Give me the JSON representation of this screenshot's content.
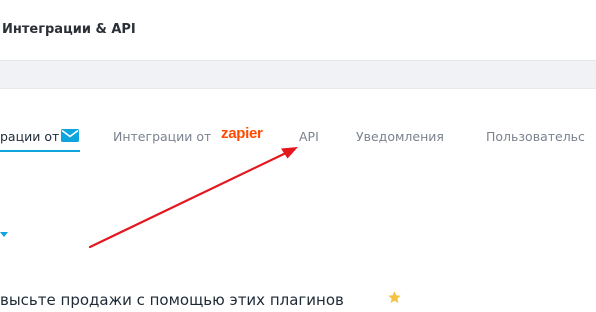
{
  "header": {
    "title": "Интеграции & API"
  },
  "tabs": [
    {
      "label": "рации от",
      "icon": "envelope-icon",
      "active": true
    },
    {
      "label": "Интеграции от",
      "brand": "zapier",
      "active": false
    },
    {
      "label": "API",
      "active": false
    },
    {
      "label": "Уведомления",
      "active": false
    },
    {
      "label": "Пользовательс",
      "active": false
    }
  ],
  "promo": {
    "text": "высьте продажи с помощью этих плагинов",
    "icon": "star-icon"
  },
  "annotation": {
    "type": "red-arrow",
    "points_to": "API",
    "color": "#e4171f"
  },
  "colors": {
    "accent": "#0ea5df",
    "zapier": "#ff4a00",
    "star": "#f5c342"
  }
}
